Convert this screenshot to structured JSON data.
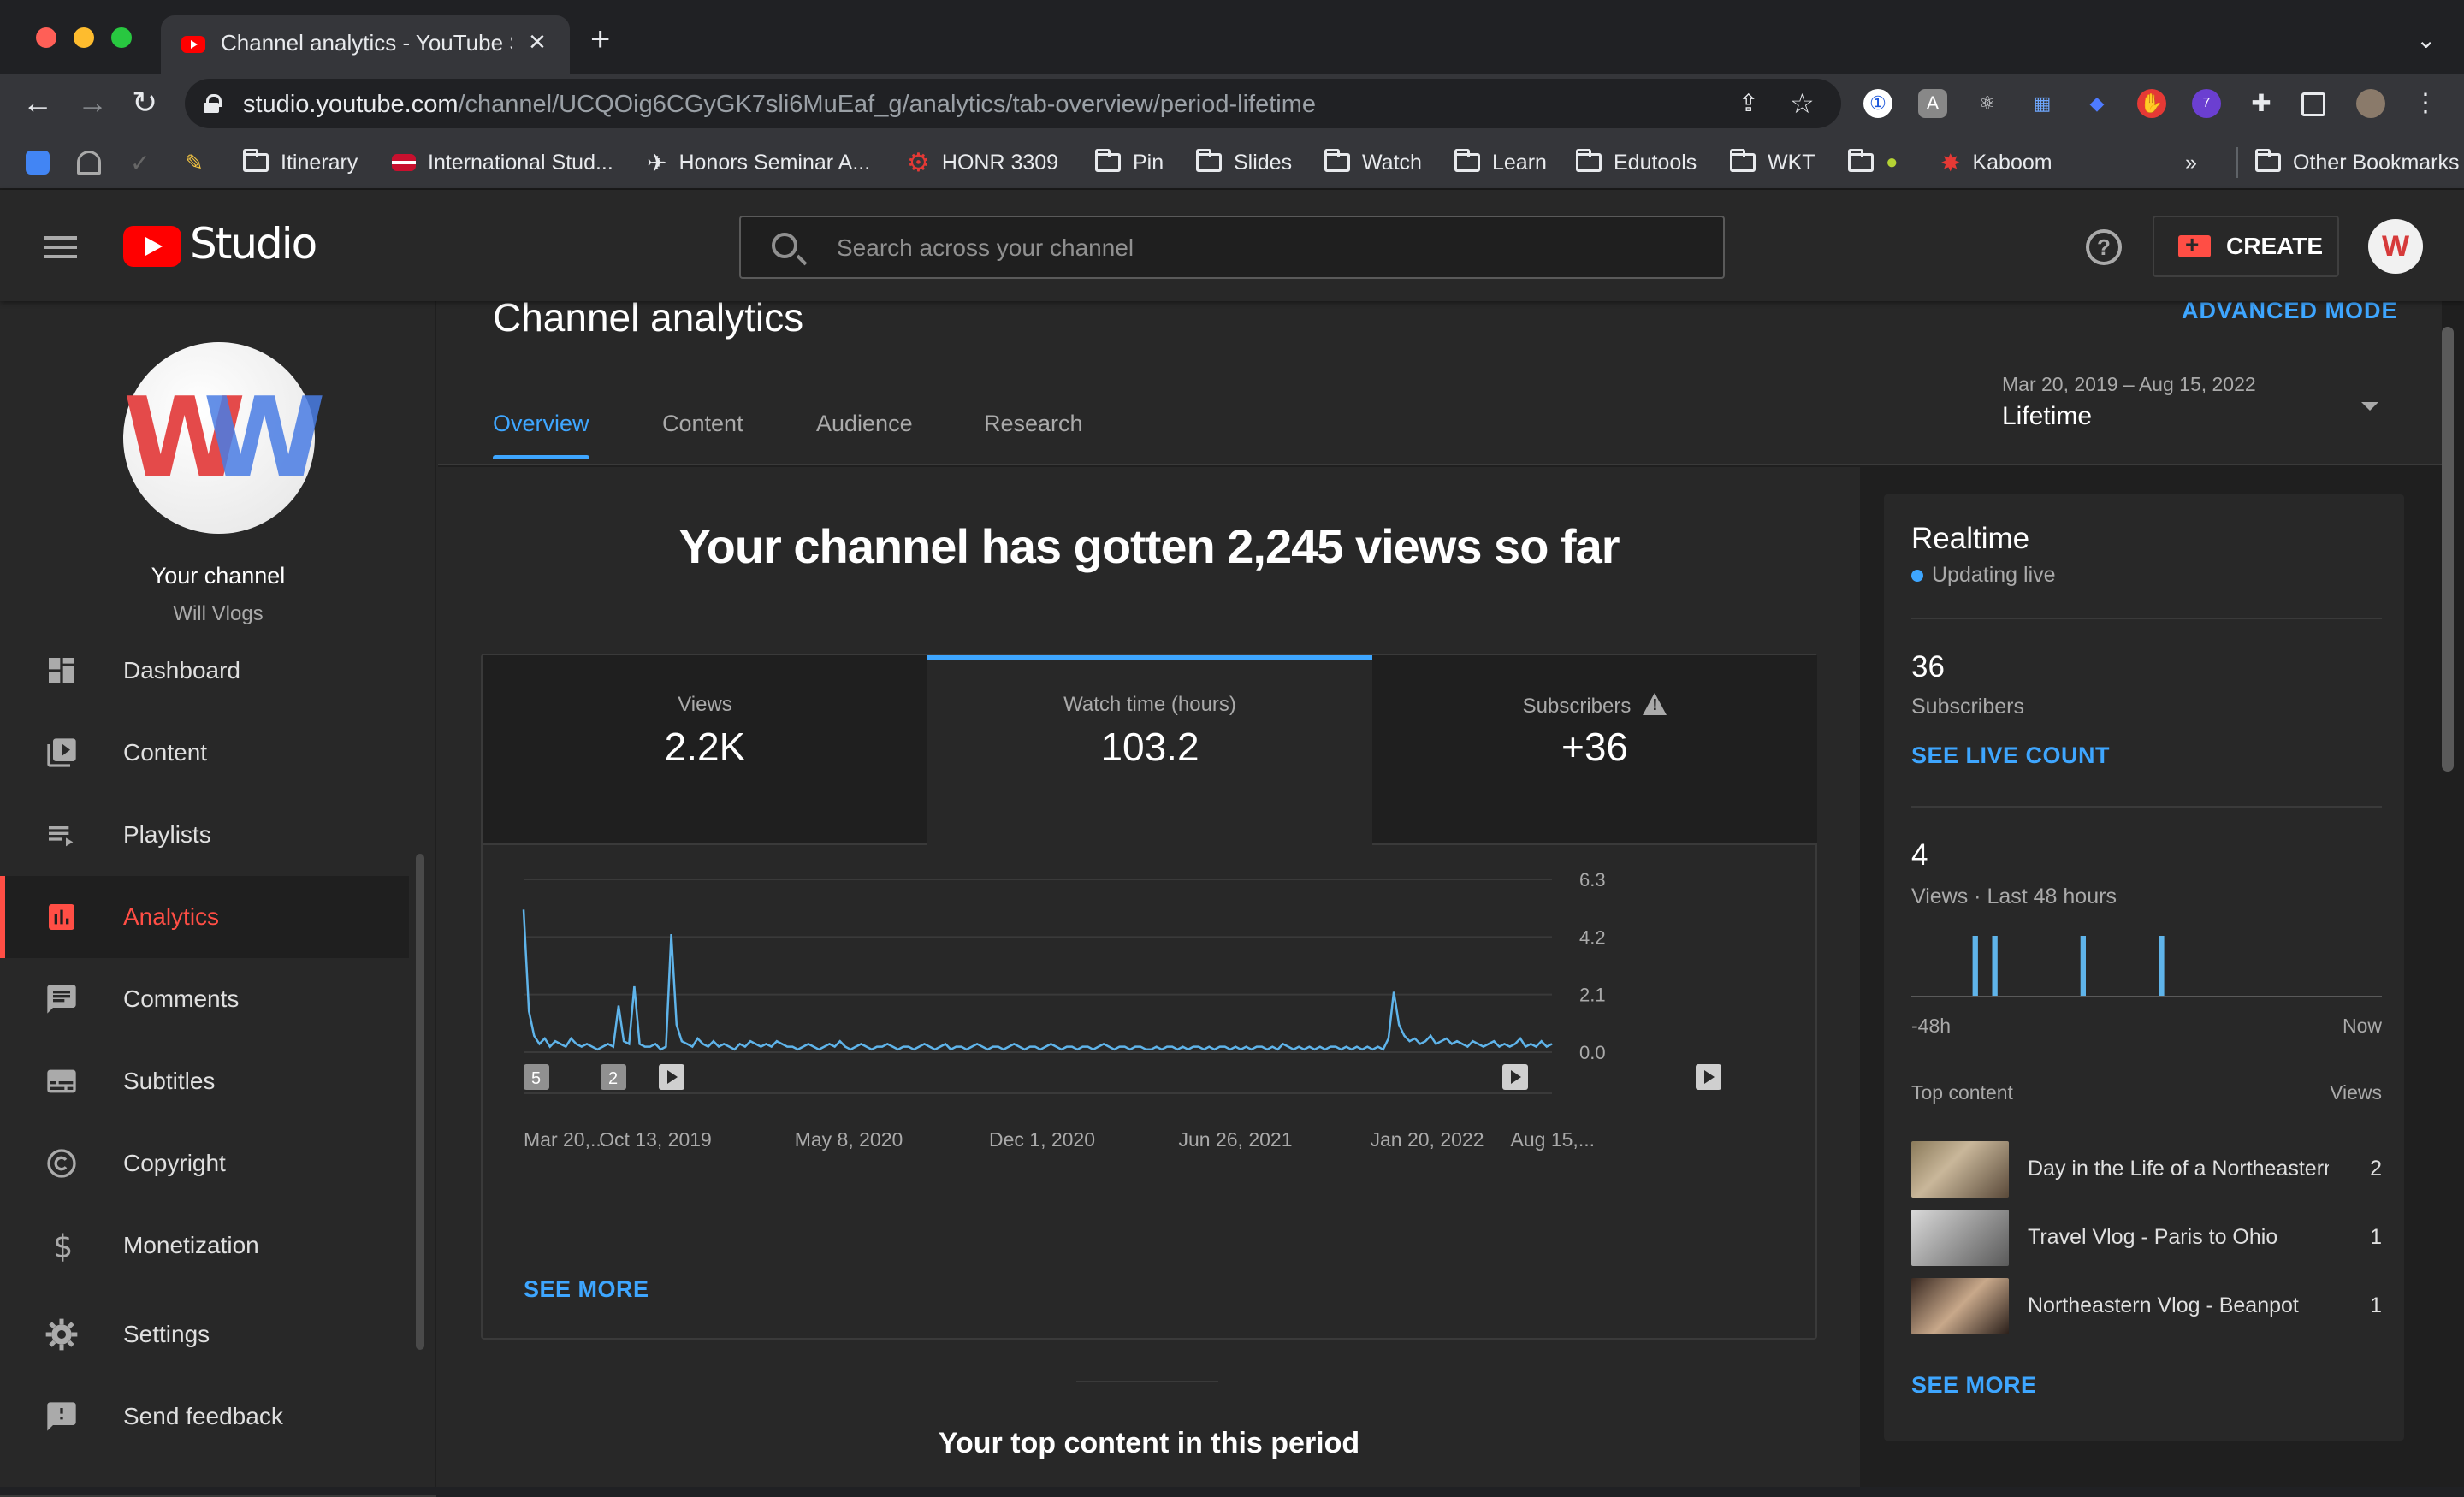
{
  "browser": {
    "tab_title": "Channel analytics - YouTube Studio",
    "url_host": "studio.youtube.com",
    "url_path": "/channel/UCQOig6CGyGK7sli6MuEaf_g/analytics/tab-overview/period-lifetime",
    "bookmarks": [
      {
        "label": "",
        "icon": "calendar-icon"
      },
      {
        "label": "",
        "icon": "astro-icon"
      },
      {
        "label": "",
        "icon": "check-icon"
      },
      {
        "label": "",
        "icon": "pencil-icon"
      },
      {
        "label": "Itinerary",
        "icon": "folder-icon"
      },
      {
        "label": "International Stud...",
        "icon": "flag-icon"
      },
      {
        "label": "Honors Seminar A...",
        "icon": "plane-icon"
      },
      {
        "label": "HONR 3309",
        "icon": "gear-icon"
      },
      {
        "label": "Pin",
        "icon": "folder-icon"
      },
      {
        "label": "Slides",
        "icon": "folder-icon"
      },
      {
        "label": "Watch",
        "icon": "folder-icon"
      },
      {
        "label": "Learn",
        "icon": "folder-icon"
      },
      {
        "label": "Edutools",
        "icon": "folder-icon"
      },
      {
        "label": "WKT",
        "icon": "folder-icon"
      },
      {
        "label": "",
        "icon": "folder-icon"
      },
      {
        "label": "Kaboom",
        "icon": "star-icon"
      }
    ],
    "overflow_label": "»",
    "other_bookmarks": "Other Bookmarks"
  },
  "studio": {
    "logo_text": "Studio",
    "search_placeholder": "Search across your channel",
    "create_label": "CREATE",
    "avatar_letter": "W"
  },
  "sidebar": {
    "channel_title": "Your channel",
    "channel_name": "Will Vlogs",
    "items": [
      {
        "label": "Dashboard",
        "icon": "dashboard-icon"
      },
      {
        "label": "Content",
        "icon": "content-icon"
      },
      {
        "label": "Playlists",
        "icon": "playlists-icon"
      },
      {
        "label": "Analytics",
        "icon": "analytics-icon"
      },
      {
        "label": "Comments",
        "icon": "comments-icon"
      },
      {
        "label": "Subtitles",
        "icon": "subtitles-icon"
      },
      {
        "label": "Copyright",
        "icon": "copyright-icon"
      },
      {
        "label": "Monetization",
        "icon": "dollar-icon"
      },
      {
        "label": "Settings",
        "icon": "gear-icon"
      },
      {
        "label": "Send feedback",
        "icon": "feedback-icon"
      }
    ]
  },
  "page": {
    "title": "Channel analytics",
    "advanced_mode": "ADVANCED MODE",
    "tabs": [
      "Overview",
      "Content",
      "Audience",
      "Research"
    ],
    "date_range": "Mar 20, 2019 – Aug 15, 2022",
    "period": "Lifetime",
    "headline": "Your channel has gotten 2,245 views so far",
    "metrics": [
      {
        "label": "Views",
        "value": "2.2K"
      },
      {
        "label": "Watch time (hours)",
        "value": "103.2"
      },
      {
        "label": "Subscribers",
        "value": "+36"
      }
    ],
    "see_more": "SEE MORE",
    "top_content_heading": "Your top content in this period"
  },
  "chart_data": {
    "type": "line",
    "title": "",
    "xlabel": "",
    "ylabel": "",
    "ylim": [
      0,
      6.3
    ],
    "y_ticks": [
      "6.3",
      "4.2",
      "2.1",
      "0.0"
    ],
    "x_tick_labels": [
      "Mar 20,...",
      "Oct 13, 2019",
      "May 8, 2020",
      "Dec 1, 2020",
      "Jun 26, 2021",
      "Jan 20, 2022",
      "Aug 15,..."
    ],
    "markers": [
      "5",
      "2",
      "",
      "",
      ""
    ],
    "series": [
      {
        "values": [
          5.2,
          1.5,
          0.6,
          0.3,
          0.5,
          0.2,
          0.4,
          0.3,
          0.2,
          0.5,
          0.3,
          0.2,
          0.3,
          0.2,
          0.1,
          0.2,
          0.3,
          0.2,
          1.7,
          0.4,
          0.3,
          2.4,
          0.3,
          0.2,
          0.2,
          0.3,
          0.1,
          0.2,
          4.3,
          1.0,
          0.4,
          0.3,
          0.2,
          0.5,
          0.3,
          0.2,
          0.4,
          0.2,
          0.3,
          0.2,
          0.1,
          0.3,
          0.2,
          0.4,
          0.3,
          0.2,
          0.3,
          0.2,
          0.4,
          0.3,
          0.2,
          0.2,
          0.1,
          0.2,
          0.3,
          0.2,
          0.1,
          0.2,
          0.3,
          0.2,
          0.4,
          0.2,
          0.1,
          0.2,
          0.3,
          0.2,
          0.1,
          0.2,
          0.2,
          0.3,
          0.2,
          0.1,
          0.2,
          0.2,
          0.1,
          0.2,
          0.3,
          0.2,
          0.1,
          0.2,
          0.3,
          0.1,
          0.2,
          0.2,
          0.1,
          0.2,
          0.3,
          0.2,
          0.1,
          0.2,
          0.2,
          0.1,
          0.2,
          0.3,
          0.2,
          0.1,
          0.2,
          0.2,
          0.1,
          0.2,
          0.3,
          0.2,
          0.1,
          0.2,
          0.2,
          0.1,
          0.2,
          0.2,
          0.1,
          0.2,
          0.3,
          0.2,
          0.1,
          0.2,
          0.2,
          0.1,
          0.2,
          0.2,
          0.1,
          0.1,
          0.2,
          0.1,
          0.2,
          0.2,
          0.1,
          0.2,
          0.1,
          0.2,
          0.2,
          0.1,
          0.2,
          0.1,
          0.2,
          0.2,
          0.1,
          0.2,
          0.1,
          0.2,
          0.1,
          0.2,
          0.2,
          0.1,
          0.2,
          0.1,
          0.3,
          0.2,
          0.1,
          0.2,
          0.1,
          0.2,
          0.1,
          0.2,
          0.1,
          0.2,
          0.2,
          0.1,
          0.2,
          0.1,
          0.2,
          0.1,
          0.2,
          0.1,
          0.2,
          0.1,
          0.5,
          2.2,
          1.0,
          0.6,
          0.4,
          0.5,
          0.3,
          0.4,
          0.6,
          0.3,
          0.4,
          0.5,
          0.3,
          0.4,
          0.3,
          0.2,
          0.4,
          0.3,
          0.2,
          0.3,
          0.4,
          0.2,
          0.3,
          0.2,
          0.3,
          0.5,
          0.2,
          0.3,
          0.2,
          0.4,
          0.2,
          0.3
        ]
      }
    ]
  },
  "realtime": {
    "title": "Realtime",
    "status": "Updating live",
    "subscribers_value": "36",
    "subscribers_label": "Subscribers",
    "see_live_count": "SEE LIVE COUNT",
    "views_value": "4",
    "views_label": "Views · Last 48 hours",
    "axis_start": "-48h",
    "axis_end": "Now",
    "bars": [
      0,
      0,
      0,
      0,
      0,
      0,
      1,
      0,
      1,
      0,
      0,
      0,
      0,
      0,
      0,
      0,
      0,
      1,
      0,
      0,
      0,
      0,
      0,
      0,
      0,
      1,
      0,
      0,
      0,
      0,
      0,
      0,
      0,
      0,
      0,
      0,
      0,
      0,
      0,
      0,
      0,
      0,
      0,
      0,
      0,
      0,
      0,
      0
    ],
    "top_content_label": "Top content",
    "views_col_label": "Views",
    "top_content": [
      {
        "title": "Day in the Life of a Northeastern Student",
        "views": "2",
        "thumb": "#6b5a4a"
      },
      {
        "title": "Travel Vlog - Paris to Ohio",
        "views": "1",
        "thumb": "#a8a8a8"
      },
      {
        "title": "Northeastern Vlog - Beanpot",
        "views": "1",
        "thumb": "#4a3a32"
      }
    ],
    "see_more": "SEE MORE"
  },
  "colors": {
    "accent": "#3ea6ff",
    "active_nav": "#ff4e45",
    "chart_line": "#5fb4ea"
  }
}
